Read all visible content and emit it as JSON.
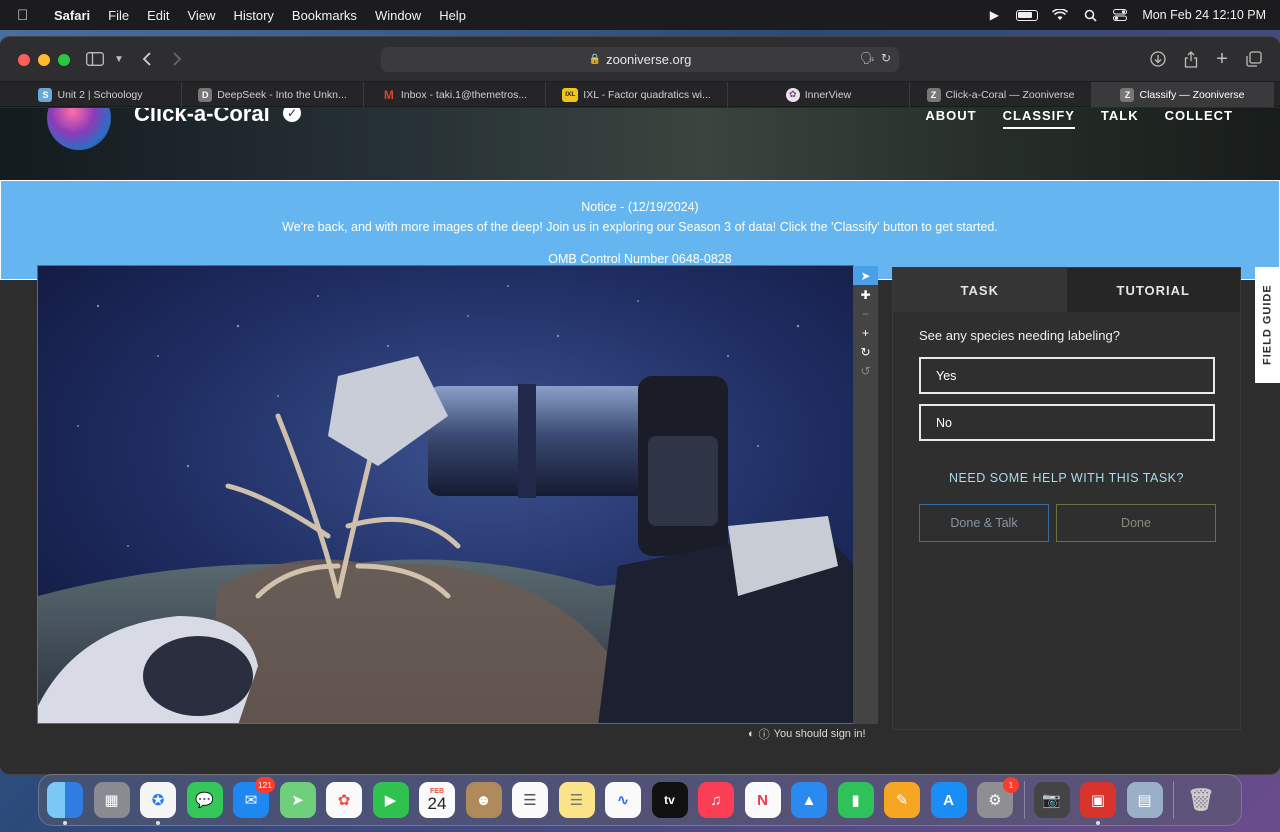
{
  "menubar": {
    "app": "Safari",
    "items": [
      "File",
      "Edit",
      "View",
      "History",
      "Bookmarks",
      "Window",
      "Help"
    ],
    "datetime": "Mon Feb 24  12:10 PM"
  },
  "browser": {
    "url": "zooniverse.org",
    "tabs": [
      {
        "label": "Unit 2 | Schoology",
        "fav": "S",
        "favcolor": "#6aa8d8"
      },
      {
        "label": "DeepSeek - Into the Unkn...",
        "fav": "D",
        "favcolor": "#777777"
      },
      {
        "label": "Inbox - taki.1@themetros...",
        "fav": "M",
        "favcolor": "#d44638"
      },
      {
        "label": "IXL - Factor quadratics wi...",
        "fav": "IXL",
        "favcolor": "#f0c419"
      },
      {
        "label": "InnerView",
        "fav": "✿",
        "favcolor": "#e6e6e6"
      },
      {
        "label": "Click-a-Coral — Zooniverse",
        "fav": "Z",
        "favcolor": "#777777"
      },
      {
        "label": "Classify — Zooniverse",
        "fav": "Z",
        "favcolor": "#777777"
      }
    ]
  },
  "project": {
    "title": "Click-a-Coral",
    "nav": [
      "ABOUT",
      "CLASSIFY",
      "TALK",
      "COLLECT"
    ]
  },
  "notice": {
    "line1": "Notice - (12/19/2024)",
    "line2": "We're back, and with more images of the deep! Join us in exploring our Season 3 of data! Click the 'Classify' button to get started.",
    "line3": "OMB Control Number 0648-0828"
  },
  "classify": {
    "tabs": [
      "TASK",
      "TUTORIAL"
    ],
    "question": "See any species needing labeling?",
    "answers": [
      "Yes",
      "No"
    ],
    "help": "NEED SOME HELP WITH THIS TASK?",
    "done_talk": "Done & Talk",
    "done": "Done",
    "sign_in": "You should sign in!",
    "field_guide": "FIELD GUIDE"
  },
  "dock": {
    "mail_badge": "121",
    "settings_badge": "1",
    "calendar_month": "FEB",
    "calendar_day": "24",
    "tv_label": "tv"
  }
}
